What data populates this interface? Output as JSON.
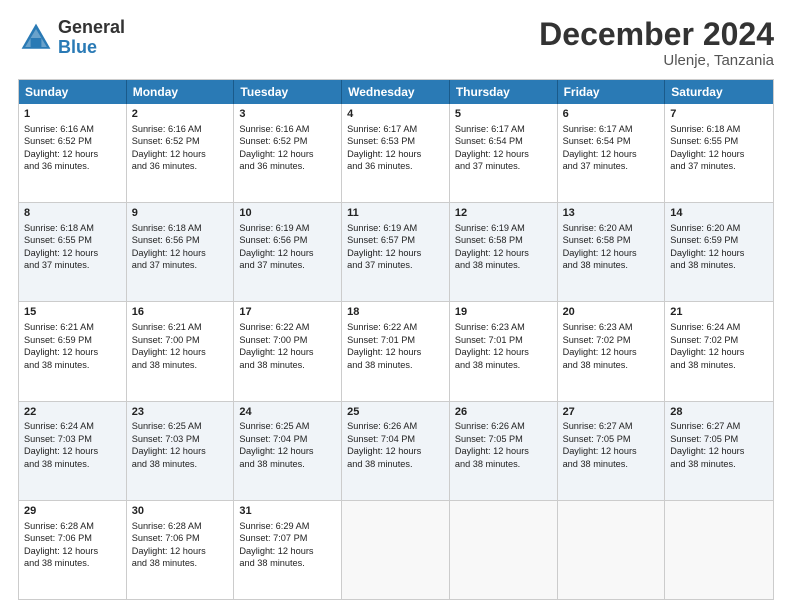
{
  "logo": {
    "line1": "General",
    "line2": "Blue"
  },
  "header": {
    "month": "December 2024",
    "location": "Ulenje, Tanzania"
  },
  "days": [
    "Sunday",
    "Monday",
    "Tuesday",
    "Wednesday",
    "Thursday",
    "Friday",
    "Saturday"
  ],
  "rows": [
    [
      {
        "day": "1",
        "lines": [
          "Sunrise: 6:16 AM",
          "Sunset: 6:52 PM",
          "Daylight: 12 hours",
          "and 36 minutes."
        ]
      },
      {
        "day": "2",
        "lines": [
          "Sunrise: 6:16 AM",
          "Sunset: 6:52 PM",
          "Daylight: 12 hours",
          "and 36 minutes."
        ]
      },
      {
        "day": "3",
        "lines": [
          "Sunrise: 6:16 AM",
          "Sunset: 6:52 PM",
          "Daylight: 12 hours",
          "and 36 minutes."
        ]
      },
      {
        "day": "4",
        "lines": [
          "Sunrise: 6:17 AM",
          "Sunset: 6:53 PM",
          "Daylight: 12 hours",
          "and 36 minutes."
        ]
      },
      {
        "day": "5",
        "lines": [
          "Sunrise: 6:17 AM",
          "Sunset: 6:54 PM",
          "Daylight: 12 hours",
          "and 37 minutes."
        ]
      },
      {
        "day": "6",
        "lines": [
          "Sunrise: 6:17 AM",
          "Sunset: 6:54 PM",
          "Daylight: 12 hours",
          "and 37 minutes."
        ]
      },
      {
        "day": "7",
        "lines": [
          "Sunrise: 6:18 AM",
          "Sunset: 6:55 PM",
          "Daylight: 12 hours",
          "and 37 minutes."
        ]
      }
    ],
    [
      {
        "day": "8",
        "lines": [
          "Sunrise: 6:18 AM",
          "Sunset: 6:55 PM",
          "Daylight: 12 hours",
          "and 37 minutes."
        ]
      },
      {
        "day": "9",
        "lines": [
          "Sunrise: 6:18 AM",
          "Sunset: 6:56 PM",
          "Daylight: 12 hours",
          "and 37 minutes."
        ]
      },
      {
        "day": "10",
        "lines": [
          "Sunrise: 6:19 AM",
          "Sunset: 6:56 PM",
          "Daylight: 12 hours",
          "and 37 minutes."
        ]
      },
      {
        "day": "11",
        "lines": [
          "Sunrise: 6:19 AM",
          "Sunset: 6:57 PM",
          "Daylight: 12 hours",
          "and 37 minutes."
        ]
      },
      {
        "day": "12",
        "lines": [
          "Sunrise: 6:19 AM",
          "Sunset: 6:58 PM",
          "Daylight: 12 hours",
          "and 38 minutes."
        ]
      },
      {
        "day": "13",
        "lines": [
          "Sunrise: 6:20 AM",
          "Sunset: 6:58 PM",
          "Daylight: 12 hours",
          "and 38 minutes."
        ]
      },
      {
        "day": "14",
        "lines": [
          "Sunrise: 6:20 AM",
          "Sunset: 6:59 PM",
          "Daylight: 12 hours",
          "and 38 minutes."
        ]
      }
    ],
    [
      {
        "day": "15",
        "lines": [
          "Sunrise: 6:21 AM",
          "Sunset: 6:59 PM",
          "Daylight: 12 hours",
          "and 38 minutes."
        ]
      },
      {
        "day": "16",
        "lines": [
          "Sunrise: 6:21 AM",
          "Sunset: 7:00 PM",
          "Daylight: 12 hours",
          "and 38 minutes."
        ]
      },
      {
        "day": "17",
        "lines": [
          "Sunrise: 6:22 AM",
          "Sunset: 7:00 PM",
          "Daylight: 12 hours",
          "and 38 minutes."
        ]
      },
      {
        "day": "18",
        "lines": [
          "Sunrise: 6:22 AM",
          "Sunset: 7:01 PM",
          "Daylight: 12 hours",
          "and 38 minutes."
        ]
      },
      {
        "day": "19",
        "lines": [
          "Sunrise: 6:23 AM",
          "Sunset: 7:01 PM",
          "Daylight: 12 hours",
          "and 38 minutes."
        ]
      },
      {
        "day": "20",
        "lines": [
          "Sunrise: 6:23 AM",
          "Sunset: 7:02 PM",
          "Daylight: 12 hours",
          "and 38 minutes."
        ]
      },
      {
        "day": "21",
        "lines": [
          "Sunrise: 6:24 AM",
          "Sunset: 7:02 PM",
          "Daylight: 12 hours",
          "and 38 minutes."
        ]
      }
    ],
    [
      {
        "day": "22",
        "lines": [
          "Sunrise: 6:24 AM",
          "Sunset: 7:03 PM",
          "Daylight: 12 hours",
          "and 38 minutes."
        ]
      },
      {
        "day": "23",
        "lines": [
          "Sunrise: 6:25 AM",
          "Sunset: 7:03 PM",
          "Daylight: 12 hours",
          "and 38 minutes."
        ]
      },
      {
        "day": "24",
        "lines": [
          "Sunrise: 6:25 AM",
          "Sunset: 7:04 PM",
          "Daylight: 12 hours",
          "and 38 minutes."
        ]
      },
      {
        "day": "25",
        "lines": [
          "Sunrise: 6:26 AM",
          "Sunset: 7:04 PM",
          "Daylight: 12 hours",
          "and 38 minutes."
        ]
      },
      {
        "day": "26",
        "lines": [
          "Sunrise: 6:26 AM",
          "Sunset: 7:05 PM",
          "Daylight: 12 hours",
          "and 38 minutes."
        ]
      },
      {
        "day": "27",
        "lines": [
          "Sunrise: 6:27 AM",
          "Sunset: 7:05 PM",
          "Daylight: 12 hours",
          "and 38 minutes."
        ]
      },
      {
        "day": "28",
        "lines": [
          "Sunrise: 6:27 AM",
          "Sunset: 7:05 PM",
          "Daylight: 12 hours",
          "and 38 minutes."
        ]
      }
    ],
    [
      {
        "day": "29",
        "lines": [
          "Sunrise: 6:28 AM",
          "Sunset: 7:06 PM",
          "Daylight: 12 hours",
          "and 38 minutes."
        ]
      },
      {
        "day": "30",
        "lines": [
          "Sunrise: 6:28 AM",
          "Sunset: 7:06 PM",
          "Daylight: 12 hours",
          "and 38 minutes."
        ]
      },
      {
        "day": "31",
        "lines": [
          "Sunrise: 6:29 AM",
          "Sunset: 7:07 PM",
          "Daylight: 12 hours",
          "and 38 minutes."
        ]
      },
      {
        "day": "",
        "lines": []
      },
      {
        "day": "",
        "lines": []
      },
      {
        "day": "",
        "lines": []
      },
      {
        "day": "",
        "lines": []
      }
    ]
  ],
  "altRows": [
    1,
    3
  ]
}
